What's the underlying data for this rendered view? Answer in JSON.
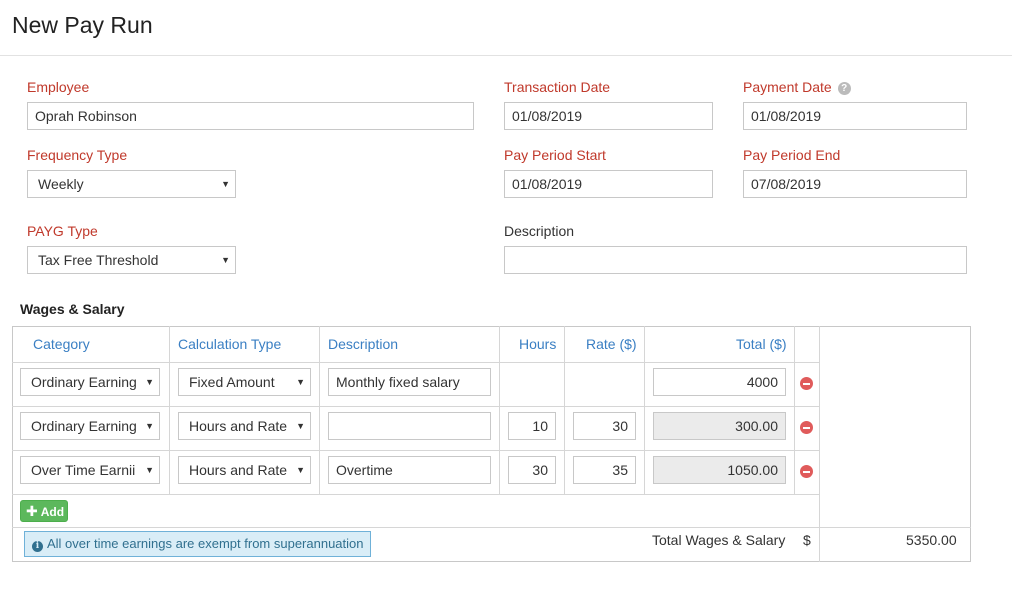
{
  "page": {
    "title": "New Pay Run"
  },
  "form": {
    "employee": {
      "label": "Employee",
      "value": "Oprah Robinson"
    },
    "transaction_date": {
      "label": "Transaction Date",
      "value": "01/08/2019"
    },
    "payment_date": {
      "label": "Payment Date",
      "value": "01/08/2019",
      "help_icon": "?"
    },
    "frequency_type": {
      "label": "Frequency Type",
      "value": "Weekly"
    },
    "pay_period_start": {
      "label": "Pay Period Start",
      "value": "01/08/2019"
    },
    "pay_period_end": {
      "label": "Pay Period End",
      "value": "07/08/2019"
    },
    "payg_type": {
      "label": "PAYG Type",
      "value": "Tax Free Threshold"
    },
    "description": {
      "label": "Description",
      "value": ""
    }
  },
  "wages": {
    "section_title": "Wages & Salary",
    "columns": {
      "category": "Category",
      "calculation_type": "Calculation Type",
      "description": "Description",
      "hours": "Hours",
      "rate": "Rate ($)",
      "total": "Total ($)"
    },
    "rows": [
      {
        "category": "Ordinary Earning",
        "calculation_type": "Fixed Amount",
        "description": "Monthly fixed salary",
        "hours": "",
        "rate": "",
        "total": "4000"
      },
      {
        "category": "Ordinary Earning",
        "calculation_type": "Hours and Rate",
        "description": "",
        "hours": "10",
        "rate": "30",
        "total": "300.00"
      },
      {
        "category": "Over Time Earnii",
        "calculation_type": "Hours and Rate",
        "description": "Overtime",
        "hours": "30",
        "rate": "35",
        "total": "1050.00"
      }
    ],
    "add_label": "Add",
    "info_text": "All over time earnings are exempt from superannuation",
    "total_label": "Total Wages & Salary",
    "currency_symbol": "$",
    "total_value": "5350.00"
  },
  "colors": {
    "label_red": "#c0392b",
    "header_blue": "#3a7fc3",
    "add_green": "#5cb85c",
    "remove_red": "#e05b5b",
    "info_bg": "#d9edf7"
  },
  "icons": {
    "caret": "chevron-down-icon",
    "help": "question-circle-icon",
    "remove": "minus-circle-icon",
    "add": "plus-icon",
    "info": "info-circle-icon"
  }
}
